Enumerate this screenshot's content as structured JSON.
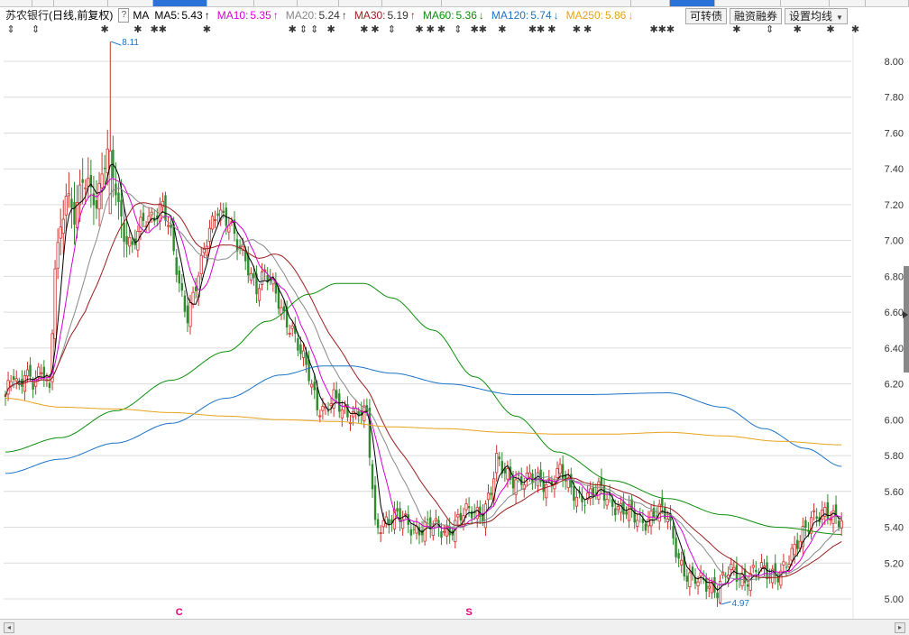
{
  "header": {
    "stock_name": "苏农银行",
    "period": "(日线,前复权)",
    "help_label": "?",
    "ma_label": "MA",
    "ma": [
      {
        "label": "MA5:",
        "value": "5.43",
        "arrow": "↑",
        "color": "#000000",
        "value_color": "#000000",
        "arrow_color": "#000000"
      },
      {
        "label": "MA10:",
        "value": "5.35",
        "arrow": "↑",
        "color": "#d400d4",
        "value_color": "#d400d4",
        "arrow_color": "#d400d4"
      },
      {
        "label": "MA20:",
        "value": "5.24",
        "arrow": "↑",
        "color": "#888888",
        "value_color": "#333333",
        "arrow_color": "#333333"
      },
      {
        "label": "MA30:",
        "value": "5.19",
        "arrow": "↑",
        "color": "#9b1c1c",
        "value_color": "#333333",
        "arrow_color": "#9b1c1c"
      },
      {
        "label": "MA60:",
        "value": "5.36",
        "arrow": "↓",
        "color": "#0a8f0a",
        "value_color": "#0a8f0a",
        "arrow_color": "#0a8f0a"
      },
      {
        "label": "MA120:",
        "value": "5.74",
        "arrow": "↓",
        "color": "#1a73c9",
        "value_color": "#1a73c9",
        "arrow_color": "#1a73c9"
      },
      {
        "label": "MA250:",
        "value": "5.86",
        "arrow": "↓",
        "color": "#e8a21a",
        "value_color": "#e8a21a",
        "arrow_color": "#e8a21a"
      }
    ]
  },
  "buttons": {
    "convertible_bond": "可转债",
    "margin_trading": "融资融券",
    "set_ma": "设置均线",
    "dropdown_icon": "triangle-down-icon"
  },
  "colors": {
    "up": "#d0312d",
    "down": "#2e8b2e",
    "grid": "#dcdcdc",
    "axis_text": "#333333",
    "marker": "#333333",
    "event_mark": "#e8007a",
    "annotation": "#1a73c9"
  },
  "chart_data": {
    "type": "candlestick",
    "ylim": [
      4.95,
      8.18
    ],
    "yticks": [
      "8.00",
      "7.80",
      "7.60",
      "7.40",
      "7.20",
      "7.00",
      "6.80",
      "6.60",
      "6.40",
      "6.20",
      "6.00",
      "5.80",
      "5.60",
      "5.40",
      "5.20",
      "5.00"
    ],
    "grid": true,
    "annotations": [
      {
        "text": "8.11",
        "price": 8.11,
        "bar": 38
      },
      {
        "text": "4.97",
        "price": 4.97,
        "bar": 259
      }
    ],
    "event_marks": [
      {
        "text": "C",
        "bar": 63
      },
      {
        "text": "S",
        "bar": 168
      }
    ],
    "top_marks": [
      {
        "bar": 2,
        "style": "arrow"
      },
      {
        "bar": 11,
        "style": "arrow"
      },
      {
        "bar": 36,
        "style": "star"
      },
      {
        "bar": 48,
        "style": "star"
      },
      {
        "bar": 54,
        "style": "star"
      },
      {
        "bar": 57,
        "style": "star"
      },
      {
        "bar": 73,
        "style": "star"
      },
      {
        "bar": 104,
        "style": "star"
      },
      {
        "bar": 108,
        "style": "arrow"
      },
      {
        "bar": 112,
        "style": "arrow"
      },
      {
        "bar": 118,
        "style": "star"
      },
      {
        "bar": 130,
        "style": "star"
      },
      {
        "bar": 134,
        "style": "star"
      },
      {
        "bar": 140,
        "style": "arrow"
      },
      {
        "bar": 150,
        "style": "star"
      },
      {
        "bar": 154,
        "style": "star"
      },
      {
        "bar": 158,
        "style": "star"
      },
      {
        "bar": 164,
        "style": "arrow"
      },
      {
        "bar": 170,
        "style": "star"
      },
      {
        "bar": 173,
        "style": "star"
      },
      {
        "bar": 180,
        "style": "star"
      },
      {
        "bar": 191,
        "style": "star"
      },
      {
        "bar": 194,
        "style": "star"
      },
      {
        "bar": 198,
        "style": "star"
      },
      {
        "bar": 207,
        "style": "star"
      },
      {
        "bar": 211,
        "style": "star"
      },
      {
        "bar": 235,
        "style": "star"
      },
      {
        "bar": 238,
        "style": "star"
      },
      {
        "bar": 241,
        "style": "star"
      },
      {
        "bar": 265,
        "style": "star"
      },
      {
        "bar": 277,
        "style": "arrow"
      },
      {
        "bar": 287,
        "style": "star"
      },
      {
        "bar": 299,
        "style": "star"
      },
      {
        "bar": 308,
        "style": "star"
      }
    ],
    "keypoints": [
      [
        0,
        6.1
      ],
      [
        3,
        6.25
      ],
      [
        5,
        6.18
      ],
      [
        7,
        6.3
      ],
      [
        10,
        6.2
      ],
      [
        14,
        6.25
      ],
      [
        16,
        6.15
      ],
      [
        18,
        6.9
      ],
      [
        22,
        7.25
      ],
      [
        25,
        7.1
      ],
      [
        28,
        7.35
      ],
      [
        30,
        7.35
      ],
      [
        33,
        7.2
      ],
      [
        37,
        7.48
      ],
      [
        40,
        7.3
      ],
      [
        43,
        7.05
      ],
      [
        46,
        6.95
      ],
      [
        50,
        7.1
      ],
      [
        53,
        7.15
      ],
      [
        57,
        7.2
      ],
      [
        60,
        7.0
      ],
      [
        63,
        6.75
      ],
      [
        66,
        6.6
      ],
      [
        68,
        6.7
      ],
      [
        71,
        6.85
      ],
      [
        74,
        7.05
      ],
      [
        77,
        7.2
      ],
      [
        81,
        7.1
      ],
      [
        84,
        6.95
      ],
      [
        87,
        6.9
      ],
      [
        91,
        6.75
      ],
      [
        94,
        6.8
      ],
      [
        98,
        6.7
      ],
      [
        101,
        6.6
      ],
      [
        104,
        6.5
      ],
      [
        107,
        6.35
      ],
      [
        110,
        6.25
      ],
      [
        113,
        6.1
      ],
      [
        116,
        6.05
      ],
      [
        119,
        6.1
      ],
      [
        122,
        6.05
      ],
      [
        125,
        6.05
      ],
      [
        128,
        6.05
      ],
      [
        131,
        6.0
      ],
      [
        132,
        5.8
      ],
      [
        134,
        5.4
      ],
      [
        137,
        5.45
      ],
      [
        141,
        5.45
      ],
      [
        145,
        5.42
      ],
      [
        149,
        5.4
      ],
      [
        153,
        5.4
      ],
      [
        157,
        5.38
      ],
      [
        161,
        5.4
      ],
      [
        165,
        5.45
      ],
      [
        169,
        5.48
      ],
      [
        173,
        5.5
      ],
      [
        176,
        5.6
      ],
      [
        178,
        5.75
      ],
      [
        181,
        5.7
      ],
      [
        185,
        5.68
      ],
      [
        189,
        5.65
      ],
      [
        193,
        5.66
      ],
      [
        197,
        5.66
      ],
      [
        201,
        5.7
      ],
      [
        204,
        5.62
      ],
      [
        208,
        5.58
      ],
      [
        212,
        5.57
      ],
      [
        216,
        5.6
      ],
      [
        220,
        5.55
      ],
      [
        224,
        5.48
      ],
      [
        228,
        5.45
      ],
      [
        232,
        5.45
      ],
      [
        236,
        5.48
      ],
      [
        240,
        5.45
      ],
      [
        243,
        5.3
      ],
      [
        246,
        5.15
      ],
      [
        249,
        5.08
      ],
      [
        252,
        5.1
      ],
      [
        255,
        5.1
      ],
      [
        258,
        5.05
      ],
      [
        261,
        5.12
      ],
      [
        264,
        5.15
      ],
      [
        268,
        5.12
      ],
      [
        272,
        5.15
      ],
      [
        276,
        5.14
      ],
      [
        280,
        5.16
      ],
      [
        283,
        5.18
      ],
      [
        286,
        5.25
      ],
      [
        289,
        5.38
      ],
      [
        292,
        5.48
      ],
      [
        295,
        5.45
      ],
      [
        298,
        5.45
      ],
      [
        301,
        5.46
      ],
      [
        303,
        5.47
      ]
    ],
    "moving_averages": [
      {
        "name": "MA5",
        "color": "#000000",
        "window": 5
      },
      {
        "name": "MA10",
        "color": "#d400d4",
        "window": 10
      },
      {
        "name": "MA20",
        "color": "#888888",
        "window": 20
      },
      {
        "name": "MA30",
        "color": "#9b1c1c",
        "window": 30
      },
      {
        "name": "MA60",
        "color": "#0a8f0a",
        "points": [
          [
            0,
            5.82
          ],
          [
            20,
            5.9
          ],
          [
            40,
            6.05
          ],
          [
            60,
            6.22
          ],
          [
            80,
            6.38
          ],
          [
            95,
            6.55
          ],
          [
            110,
            6.7
          ],
          [
            120,
            6.76
          ],
          [
            130,
            6.76
          ],
          [
            140,
            6.68
          ],
          [
            155,
            6.5
          ],
          [
            170,
            6.24
          ],
          [
            185,
            6.02
          ],
          [
            200,
            5.82
          ],
          [
            220,
            5.66
          ],
          [
            240,
            5.56
          ],
          [
            260,
            5.47
          ],
          [
            280,
            5.4
          ],
          [
            303,
            5.36
          ]
        ]
      },
      {
        "name": "MA120",
        "color": "#1a73c9",
        "points": [
          [
            0,
            5.7
          ],
          [
            20,
            5.78
          ],
          [
            40,
            5.87
          ],
          [
            60,
            5.98
          ],
          [
            80,
            6.12
          ],
          [
            100,
            6.25
          ],
          [
            115,
            6.3
          ],
          [
            125,
            6.3
          ],
          [
            140,
            6.26
          ],
          [
            160,
            6.2
          ],
          [
            185,
            6.14
          ],
          [
            210,
            6.14
          ],
          [
            240,
            6.15
          ],
          [
            260,
            6.07
          ],
          [
            275,
            5.95
          ],
          [
            290,
            5.84
          ],
          [
            303,
            5.74
          ]
        ]
      },
      {
        "name": "MA250",
        "color": "#e8a21a",
        "points": [
          [
            0,
            6.12
          ],
          [
            20,
            6.07
          ],
          [
            40,
            6.06
          ],
          [
            60,
            6.04
          ],
          [
            80,
            6.02
          ],
          [
            100,
            6.0
          ],
          [
            120,
            5.99
          ],
          [
            140,
            5.96
          ],
          [
            160,
            5.95
          ],
          [
            180,
            5.93
          ],
          [
            200,
            5.92
          ],
          [
            220,
            5.92
          ],
          [
            240,
            5.93
          ],
          [
            260,
            5.91
          ],
          [
            280,
            5.88
          ],
          [
            303,
            5.86
          ]
        ]
      }
    ],
    "bar_count": 304
  }
}
